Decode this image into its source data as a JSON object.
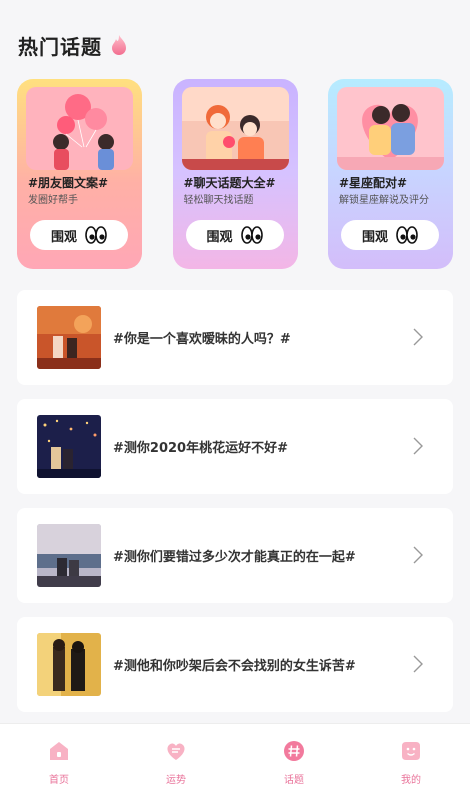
{
  "header": {
    "title": "热门话题",
    "title_icon": "flame-icon"
  },
  "featured": [
    {
      "title": "#朋友圈文案#",
      "subtitle": "发圈好帮手",
      "button": "围观"
    },
    {
      "title": "#聊天话题大全#",
      "subtitle": "轻松聊天找话题",
      "button": "围观"
    },
    {
      "title": "#星座配对#",
      "subtitle": "解锁星座解说及评分",
      "button": "围观"
    }
  ],
  "topics": [
    {
      "text": "#你是一个喜欢暧昧的人吗？#"
    },
    {
      "text": "#测你2020年桃花运好不好#"
    },
    {
      "text": "#测你们要错过多少次才能真正的在一起#"
    },
    {
      "text": "#测他和你吵架后会不会找别的女生诉苦#"
    }
  ],
  "tabbar": [
    {
      "label": "首页",
      "icon": "home-icon"
    },
    {
      "label": "运势",
      "icon": "heart-chat-icon"
    },
    {
      "label": "话题",
      "icon": "hashtag-icon"
    },
    {
      "label": "我的",
      "icon": "profile-icon"
    }
  ],
  "colors": {
    "accent": "#e9739a",
    "background": "#f6f6f8"
  }
}
